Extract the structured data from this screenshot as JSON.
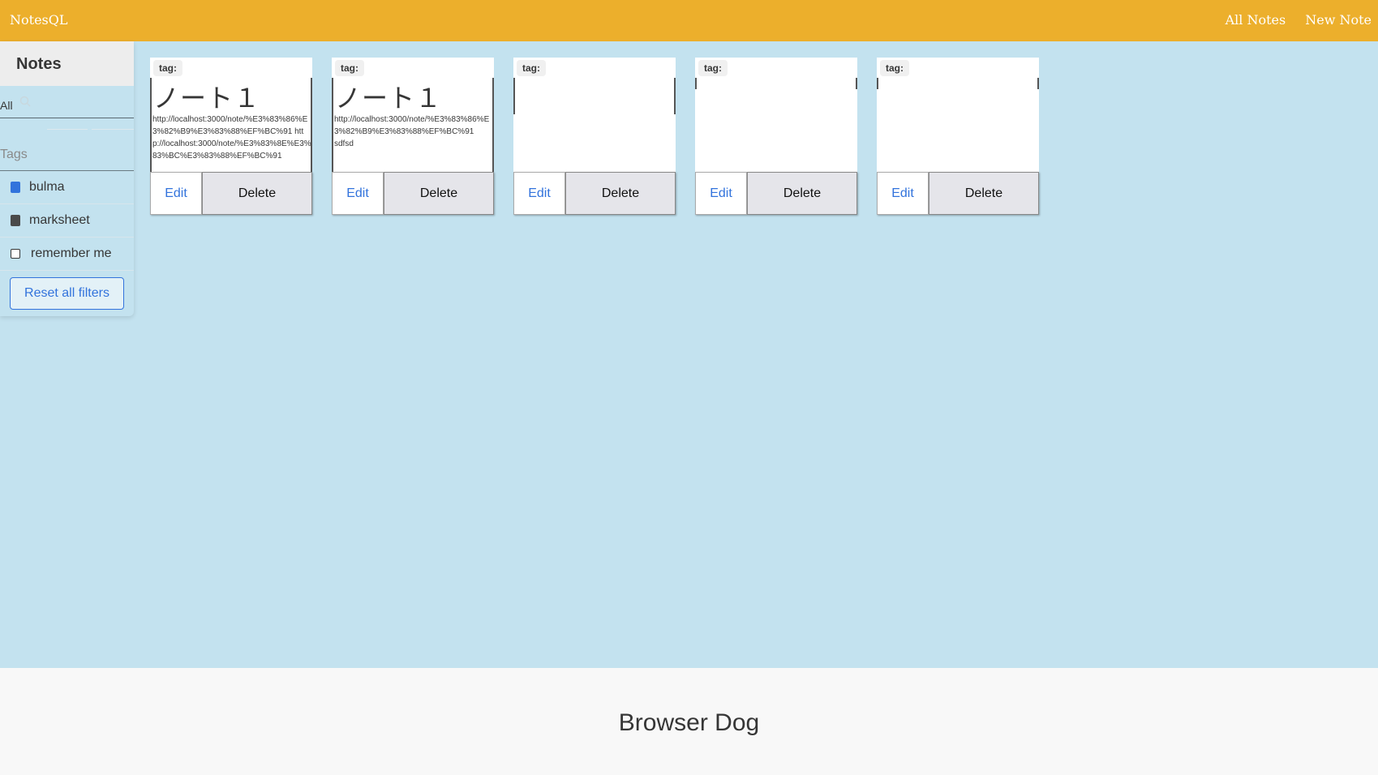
{
  "navbar": {
    "brand": "NotesQL",
    "links": [
      "All Notes",
      "New Note"
    ]
  },
  "sidebar": {
    "heading": "Notes",
    "search_prefix": "All",
    "tags_label": "Tags",
    "tags": [
      {
        "label": "bulma",
        "icon": "book-icon",
        "color": "#3273dc"
      },
      {
        "label": "marksheet",
        "icon": "book-icon",
        "color": "#4a4a4a"
      },
      {
        "label": "remember me",
        "icon": "checkbox-icon"
      }
    ],
    "reset_label": "Reset all filters"
  },
  "notes": [
    {
      "tag": "tag:",
      "title": "ノート１",
      "body": "http://localhost:3000/note/%E3%83%86%E3%82%B9%E3%83%88%EF%BC%91 http://localhost:3000/note/%E3%83%8E%E3%83%BC%E3%83%88%EF%BC%91",
      "edit_label": "Edit",
      "delete_label": "Delete"
    },
    {
      "tag": "tag:",
      "title": "ノート１",
      "body": "http://localhost:3000/note/%E3%83%86%E3%82%B9%E3%83%88%EF%BC%91\nsdfsd",
      "edit_label": "Edit",
      "delete_label": "Delete"
    },
    {
      "tag": "tag:",
      "title": "",
      "body": "",
      "edit_label": "Edit",
      "delete_label": "Delete"
    },
    {
      "tag": "tag:",
      "title": "",
      "body": "",
      "edit_label": "Edit",
      "delete_label": "Delete"
    },
    {
      "tag": "tag:",
      "title": "",
      "body": "",
      "edit_label": "Edit",
      "delete_label": "Delete"
    }
  ],
  "footer": {
    "text": "Browser Dog"
  }
}
